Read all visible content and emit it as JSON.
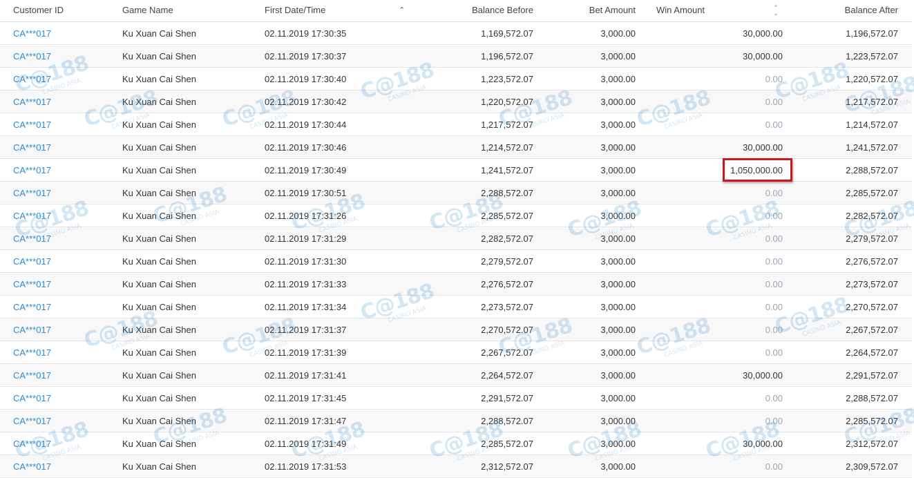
{
  "columns": {
    "customer_id": "Customer ID",
    "game_name": "Game Name",
    "first_datetime": "First Date/Time",
    "balance_before": "Balance Before",
    "bet_amount": "Bet Amount",
    "win_amount": "Win Amount",
    "balance_after": "Balance After"
  },
  "sort_icons": {
    "first_datetime": "sort-ascending-icon",
    "win_amount": "sort-both-icon"
  },
  "colors": {
    "link": "#2a8ad4",
    "zero_value": "#9aa7b4",
    "highlight_box": "#d0161c",
    "watermark": "#3d8fd1"
  },
  "watermark": {
    "mark": "C@188",
    "text": "CASINO ASIA"
  },
  "rows": [
    {
      "customer_id": "CA***017",
      "game_name": "Ku Xuan Cai Shen",
      "datetime": "02.11.2019 17:30:35",
      "balance_before": "1,169,572.07",
      "bet_amount": "3,000.00",
      "win_amount": "30,000.00",
      "balance_after": "1,196,572.07"
    },
    {
      "customer_id": "CA***017",
      "game_name": "Ku Xuan Cai Shen",
      "datetime": "02.11.2019 17:30:37",
      "balance_before": "1,196,572.07",
      "bet_amount": "3,000.00",
      "win_amount": "30,000.00",
      "balance_after": "1,223,572.07"
    },
    {
      "customer_id": "CA***017",
      "game_name": "Ku Xuan Cai Shen",
      "datetime": "02.11.2019 17:30:40",
      "balance_before": "1,223,572.07",
      "bet_amount": "3,000.00",
      "win_amount": "0.00",
      "balance_after": "1,220,572.07"
    },
    {
      "customer_id": "CA***017",
      "game_name": "Ku Xuan Cai Shen",
      "datetime": "02.11.2019 17:30:42",
      "balance_before": "1,220,572.07",
      "bet_amount": "3,000.00",
      "win_amount": "0.00",
      "balance_after": "1,217,572.07"
    },
    {
      "customer_id": "CA***017",
      "game_name": "Ku Xuan Cai Shen",
      "datetime": "02.11.2019 17:30:44",
      "balance_before": "1,217,572.07",
      "bet_amount": "3,000.00",
      "win_amount": "0.00",
      "balance_after": "1,214,572.07"
    },
    {
      "customer_id": "CA***017",
      "game_name": "Ku Xuan Cai Shen",
      "datetime": "02.11.2019 17:30:46",
      "balance_before": "1,214,572.07",
      "bet_amount": "3,000.00",
      "win_amount": "30,000.00",
      "balance_after": "1,241,572.07"
    },
    {
      "customer_id": "CA***017",
      "game_name": "Ku Xuan Cai Shen",
      "datetime": "02.11.2019 17:30:49",
      "balance_before": "1,241,572.07",
      "bet_amount": "3,000.00",
      "win_amount": "1,050,000.00",
      "balance_after": "2,288,572.07"
    },
    {
      "customer_id": "CA***017",
      "game_name": "Ku Xuan Cai Shen",
      "datetime": "02.11.2019 17:30:51",
      "balance_before": "2,288,572.07",
      "bet_amount": "3,000.00",
      "win_amount": "0.00",
      "balance_after": "2,285,572.07"
    },
    {
      "customer_id": "CA***017",
      "game_name": "Ku Xuan Cai Shen",
      "datetime": "02.11.2019 17:31:26",
      "balance_before": "2,285,572.07",
      "bet_amount": "3,000.00",
      "win_amount": "0.00",
      "balance_after": "2,282,572.07"
    },
    {
      "customer_id": "CA***017",
      "game_name": "Ku Xuan Cai Shen",
      "datetime": "02.11.2019 17:31:29",
      "balance_before": "2,282,572.07",
      "bet_amount": "3,000.00",
      "win_amount": "0.00",
      "balance_after": "2,279,572.07"
    },
    {
      "customer_id": "CA***017",
      "game_name": "Ku Xuan Cai Shen",
      "datetime": "02.11.2019 17:31:30",
      "balance_before": "2,279,572.07",
      "bet_amount": "3,000.00",
      "win_amount": "0.00",
      "balance_after": "2,276,572.07"
    },
    {
      "customer_id": "CA***017",
      "game_name": "Ku Xuan Cai Shen",
      "datetime": "02.11.2019 17:31:33",
      "balance_before": "2,276,572.07",
      "bet_amount": "3,000.00",
      "win_amount": "0.00",
      "balance_after": "2,273,572.07"
    },
    {
      "customer_id": "CA***017",
      "game_name": "Ku Xuan Cai Shen",
      "datetime": "02.11.2019 17:31:34",
      "balance_before": "2,273,572.07",
      "bet_amount": "3,000.00",
      "win_amount": "0.00",
      "balance_after": "2,270,572.07"
    },
    {
      "customer_id": "CA***017",
      "game_name": "Ku Xuan Cai Shen",
      "datetime": "02.11.2019 17:31:37",
      "balance_before": "2,270,572.07",
      "bet_amount": "3,000.00",
      "win_amount": "0.00",
      "balance_after": "2,267,572.07"
    },
    {
      "customer_id": "CA***017",
      "game_name": "Ku Xuan Cai Shen",
      "datetime": "02.11.2019 17:31:39",
      "balance_before": "2,267,572.07",
      "bet_amount": "3,000.00",
      "win_amount": "0.00",
      "balance_after": "2,264,572.07"
    },
    {
      "customer_id": "CA***017",
      "game_name": "Ku Xuan Cai Shen",
      "datetime": "02.11.2019 17:31:41",
      "balance_before": "2,264,572.07",
      "bet_amount": "3,000.00",
      "win_amount": "30,000.00",
      "balance_after": "2,291,572.07"
    },
    {
      "customer_id": "CA***017",
      "game_name": "Ku Xuan Cai Shen",
      "datetime": "02.11.2019 17:31:45",
      "balance_before": "2,291,572.07",
      "bet_amount": "3,000.00",
      "win_amount": "0.00",
      "balance_after": "2,288,572.07"
    },
    {
      "customer_id": "CA***017",
      "game_name": "Ku Xuan Cai Shen",
      "datetime": "02.11.2019 17:31:47",
      "balance_before": "2,288,572.07",
      "bet_amount": "3,000.00",
      "win_amount": "0.00",
      "balance_after": "2,285,572.07"
    },
    {
      "customer_id": "CA***017",
      "game_name": "Ku Xuan Cai Shen",
      "datetime": "02.11.2019 17:31:49",
      "balance_before": "2,285,572.07",
      "bet_amount": "3,000.00",
      "win_amount": "30,000.00",
      "balance_after": "2,312,572.07"
    },
    {
      "customer_id": "CA***017",
      "game_name": "Ku Xuan Cai Shen",
      "datetime": "02.11.2019 17:31:53",
      "balance_before": "2,312,572.07",
      "bet_amount": "3,000.00",
      "win_amount": "0.00",
      "balance_after": "2,309,572.07"
    }
  ]
}
